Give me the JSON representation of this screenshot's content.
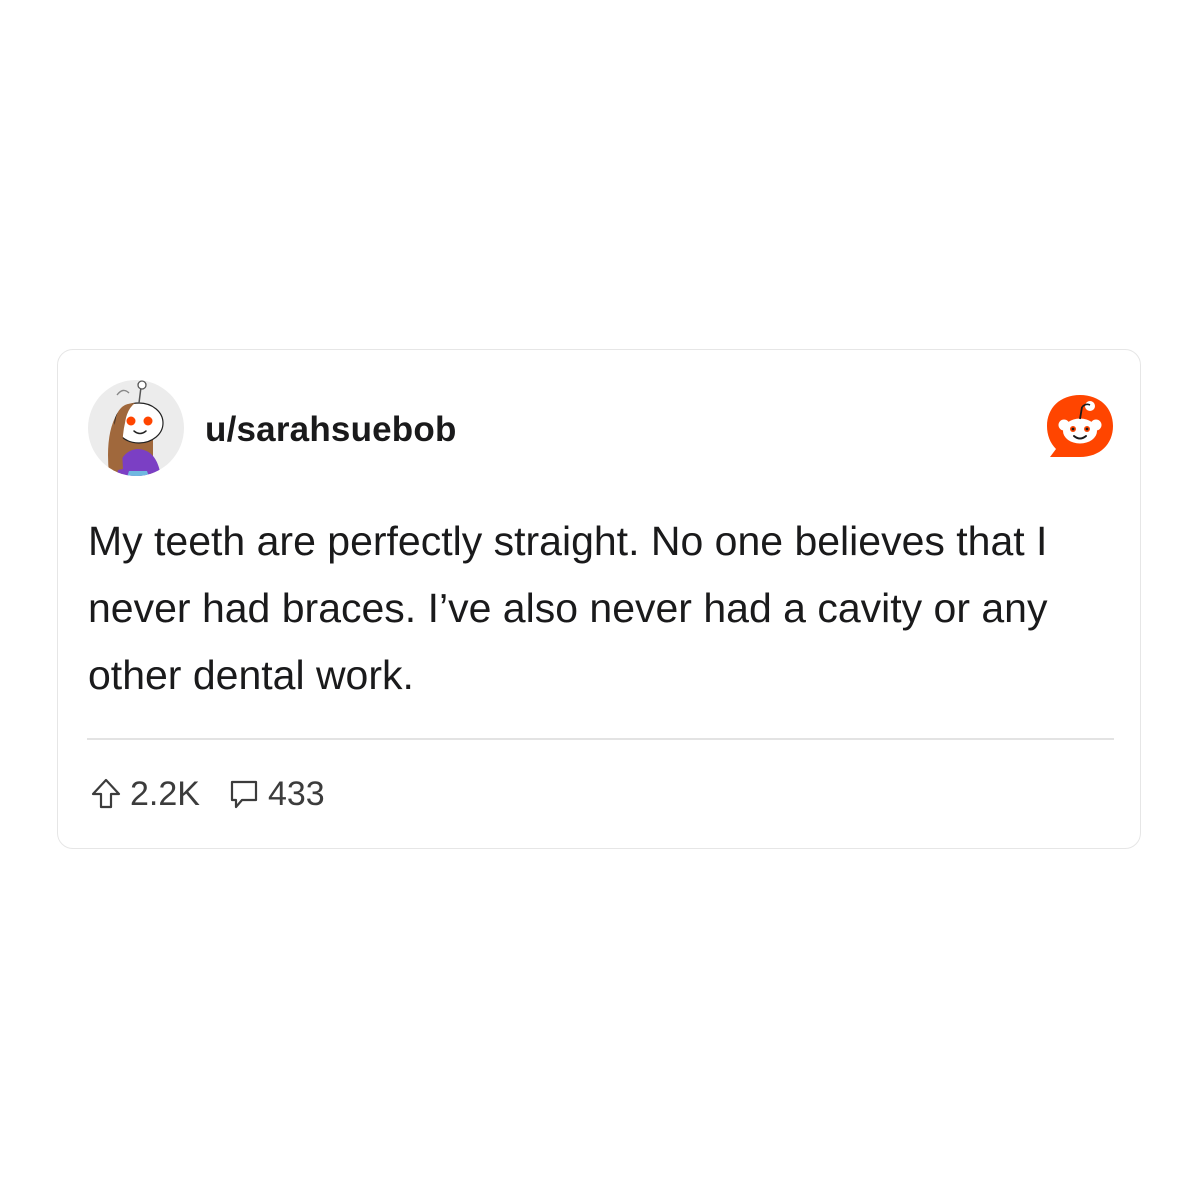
{
  "post": {
    "username": "u/sarahsuebob",
    "body": "My teeth are perfectly straight. No one believes that I never had braces. I’ve also never had a cavity or any other dental work.",
    "upvotes": "2.2K",
    "comments": "433"
  },
  "icons": {
    "avatar": "snoo-avatar",
    "brand": "reddit-logo-icon",
    "upvote": "upvote-arrow-icon",
    "comment": "comment-bubble-icon"
  },
  "colors": {
    "brand_orange": "#ff4500",
    "text": "#1a1a1b",
    "meta_text": "#3c3c3c",
    "border": "#e6e6e6",
    "avatar_shirt": "#7b3fc4",
    "avatar_hair": "#a0683c"
  }
}
